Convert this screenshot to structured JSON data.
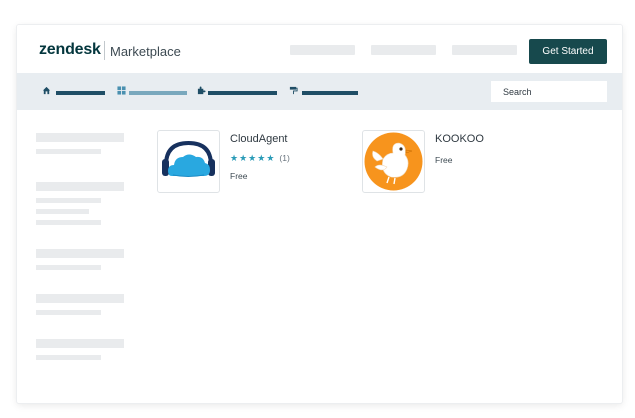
{
  "header": {
    "brand": "zendesk",
    "section": "Marketplace",
    "cta_label": "Get Started"
  },
  "subbar": {
    "search_placeholder": "Search",
    "icons": [
      "home-icon",
      "grid-icon",
      "puzzle-icon",
      "paint-roller-icon"
    ]
  },
  "apps": [
    {
      "name": "CloudAgent",
      "rating_stars": 5,
      "rating_count": "(1)",
      "price": "Free",
      "logo": "headset-cloud-logo"
    },
    {
      "name": "KOOKOO",
      "price": "Free",
      "logo": "bird-logo"
    }
  ],
  "colors": {
    "brand_dark": "#17494d",
    "subbar_bg": "#e8edf1",
    "star": "#2a9bb7",
    "kookoo_orange": "#f7941d",
    "cloud_blue": "#29a8e0"
  }
}
